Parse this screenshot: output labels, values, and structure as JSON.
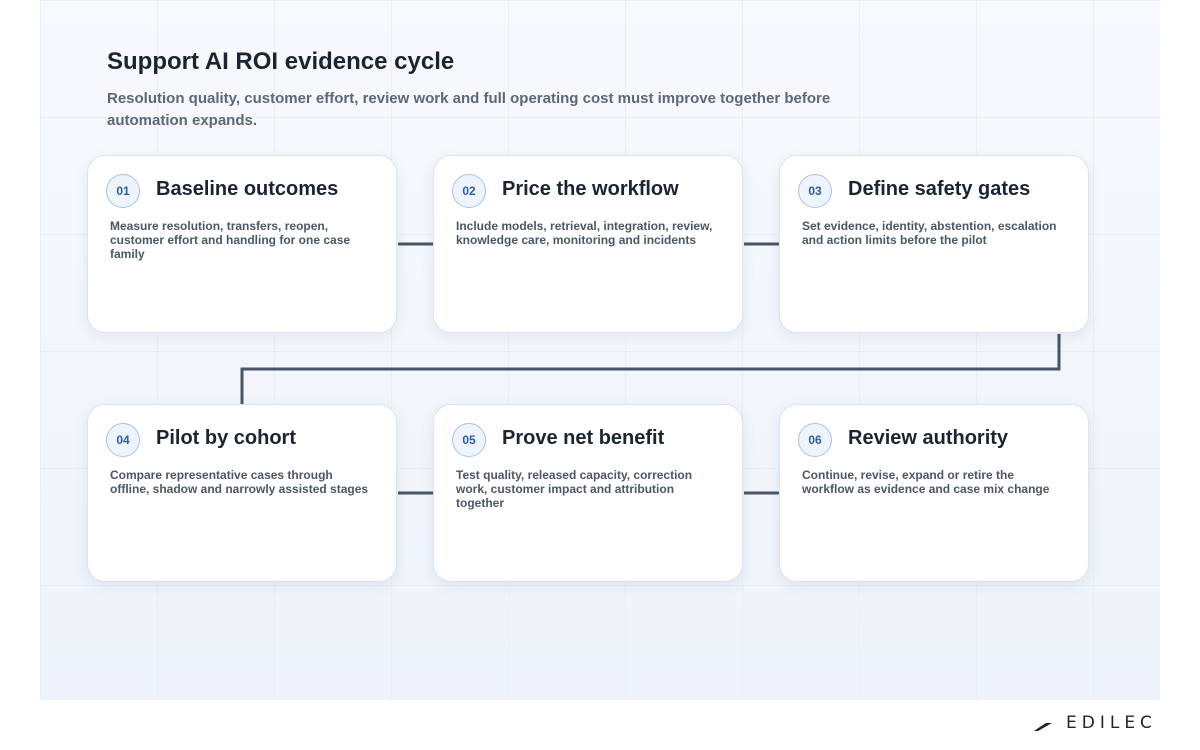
{
  "header": {
    "title": "Support AI ROI evidence cycle",
    "subtitle": "Resolution quality, customer effort, review work and full operating cost must improve together before automation expands."
  },
  "steps": [
    {
      "number": "01",
      "title": "Baseline outcomes",
      "text": "Measure resolution, transfers, reopen, customer effort and handling for one case family"
    },
    {
      "number": "02",
      "title": "Price the workflow",
      "text": "Include models, retrieval, integration, review, knowledge care, monitoring and incidents"
    },
    {
      "number": "03",
      "title": "Define safety gates",
      "text": "Set evidence, identity, abstention, escalation and action limits before the pilot"
    },
    {
      "number": "04",
      "title": "Pilot by cohort",
      "text": "Compare representative cases through offline, shadow and narrowly assisted stages"
    },
    {
      "number": "05",
      "title": "Prove net benefit",
      "text": "Test quality, released capacity, correction work, customer impact and attribution together"
    },
    {
      "number": "06",
      "title": "Review authority",
      "text": "Continue, revise, expand or retire the workflow as evidence and case mix change"
    }
  ],
  "brand": {
    "name": "EDILEC",
    "icon": "brand-logo-icon"
  },
  "colors": {
    "connector": "#4a5568",
    "number_accent": "#2f5d9c",
    "number_ring": "#a9c2e6"
  }
}
